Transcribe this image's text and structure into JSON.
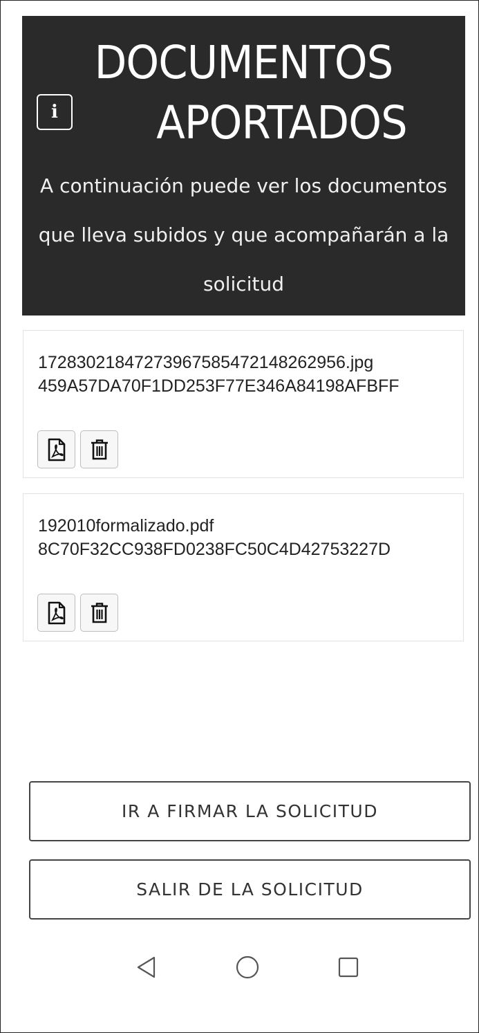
{
  "header": {
    "title_line1": "DOCUMENTOS",
    "title_line2": "APORTADOS",
    "info_icon": "info-icon",
    "subtitle": "A continuación puede ver los documentos que lleva subidos y que acompañarán a la solicitud"
  },
  "documents": [
    {
      "name": "17283021847273967585472148262956.jpg",
      "hash": "459A57DA70F1DD253F77E346A84198AFBFF",
      "view_icon": "pdf-file-icon",
      "delete_icon": "trash-icon"
    },
    {
      "name": "192010formalizado.pdf",
      "hash": "8C70F32CC938FD0238FC50C4D42753227D",
      "view_icon": "pdf-file-icon",
      "delete_icon": "trash-icon"
    }
  ],
  "actions": {
    "sign_label": "IR A FIRMAR LA SOLICITUD",
    "exit_label": "SALIR DE LA SOLICITUD"
  },
  "navbar": {
    "back_icon": "back-triangle-icon",
    "home_icon": "home-circle-icon",
    "recent_icon": "recent-apps-square-icon"
  },
  "colors": {
    "header_bg": "#2a2a2a",
    "header_text": "#ffffff",
    "button_border": "#444444",
    "card_border": "#e2e2e2"
  }
}
